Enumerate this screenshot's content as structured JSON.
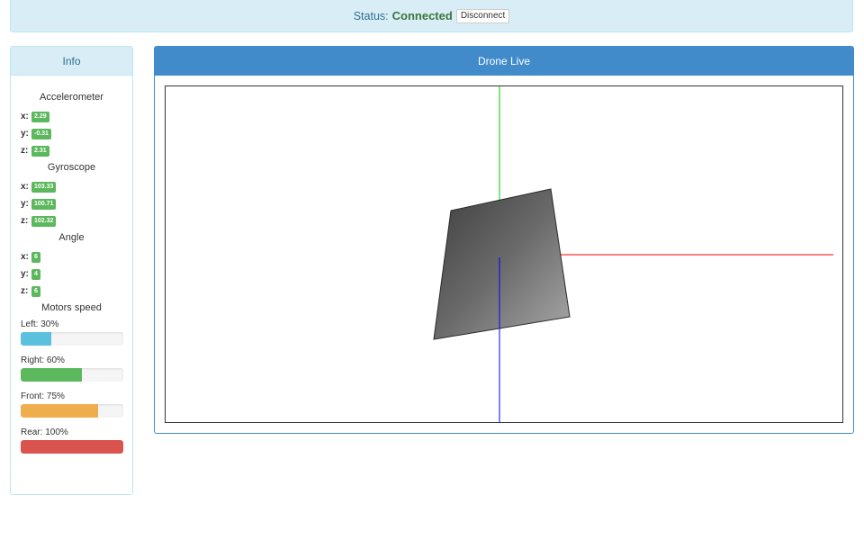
{
  "status": {
    "label": "Status:",
    "value": "Connected",
    "disconnect_label": "Disconnect"
  },
  "info": {
    "title": "Info",
    "accelerometer": {
      "title": "Accelerometer",
      "x": "2.29",
      "y": "-0.31",
      "z": "2.31"
    },
    "gyroscope": {
      "title": "Gyroscope",
      "x": "103.33",
      "y": "100.71",
      "z": "102.32"
    },
    "angle": {
      "title": "Angle",
      "x": "6",
      "y": "4",
      "z": "6"
    },
    "axis_labels": {
      "x": "x:",
      "y": "y:",
      "z": "z:"
    },
    "motors": {
      "title": "Motors speed",
      "items": [
        {
          "label": "Left: 30%",
          "percent": 30,
          "color": "#5bc0de"
        },
        {
          "label": "Right: 60%",
          "percent": 60,
          "color": "#5cb85c"
        },
        {
          "label": "Front: 75%",
          "percent": 75,
          "color": "#f0ad4e"
        },
        {
          "label": "Rear: 100%",
          "percent": 100,
          "color": "#d9534f"
        }
      ]
    }
  },
  "drone": {
    "title": "Drone Live",
    "axis_colors": {
      "x": "#ff0000",
      "y": "#00cc00",
      "z": "#0000ff"
    }
  }
}
